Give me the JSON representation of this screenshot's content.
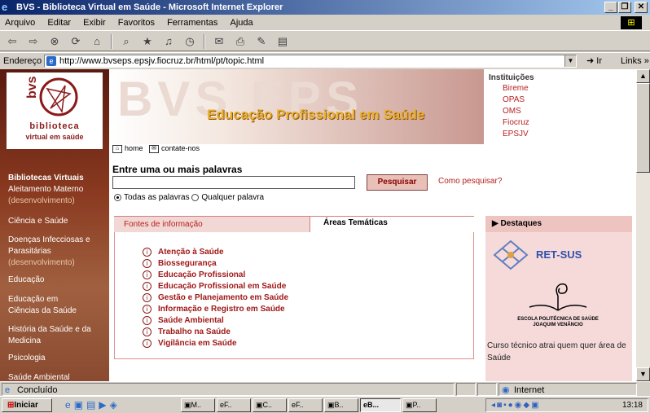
{
  "window": {
    "title": "BVS - Biblioteca Virtual em Saúde - Microsoft Internet Explorer",
    "min": "_",
    "max": "❐",
    "close": "✕"
  },
  "menu": [
    "Arquivo",
    "Editar",
    "Exibir",
    "Favoritos",
    "Ferramentas",
    "Ajuda"
  ],
  "address": {
    "label": "Endereço",
    "url": "http://www.bvseps.epsjv.fiocruz.br/html/pt/topic.html",
    "go": "Ir",
    "links": "Links »"
  },
  "logo": {
    "line1": "biblioteca",
    "line2": "virtual em saúde"
  },
  "banner": {
    "big": "BVS EPS",
    "heading": "Educação Profissional em Saúde"
  },
  "institutions": {
    "title": "Instituições",
    "items": [
      "Bireme",
      "OPAS",
      "OMS",
      "Fiocruz",
      "EPSJV"
    ]
  },
  "toplinks": {
    "home": "home",
    "contact": "contate-nos"
  },
  "search": {
    "title": "Entre uma ou mais palavras",
    "button": "Pesquisar",
    "howto": "Como pesquisar?",
    "opt_all": "Todas as palavras",
    "opt_any": "Qualquer palavra"
  },
  "sidebar": {
    "heading": "Bibliotecas Virtuais",
    "items": [
      {
        "label": "Aleitamento Materno",
        "note": "(desenvolvimento)"
      },
      {
        "label": "Ciência e Saúde"
      },
      {
        "label": "Doenças Infecciosas e Parasitárias",
        "note": "(desenvolvimento)"
      },
      {
        "label": "Educação"
      },
      {
        "label": "Educação em Ciências da Saúde"
      },
      {
        "label": "História da Saúde e da Medicina"
      },
      {
        "label": "Psicologia"
      },
      {
        "label": "Saúde Ambiental"
      }
    ]
  },
  "tabs": {
    "sources": "Fontes de informação",
    "areas": "Áreas Temáticas"
  },
  "topics": [
    "Atenção à Saúde",
    "Biossegurança",
    "Educação Profissional",
    "Educação Profissional em Saúde",
    "Gestão e Planejamento em Saúde",
    "Informação e Registro em Saúde",
    "Saúde Ambiental",
    "Trabalho na Saúde",
    "Vigilância em Saúde"
  ],
  "highlights": {
    "title": "Destaques",
    "retsus": "RET-SUS",
    "escola1": "ESCOLA POLITÉCNICA DE SAÚDE",
    "escola2": "JOAQUIM VENÂNCIO",
    "news": "Curso técnico atrai quem quer área de Saúde"
  },
  "status": {
    "left": "Concluído",
    "zone": "Internet"
  },
  "taskbar": {
    "start": "Iniciar",
    "buttons": [
      "M..",
      "F..",
      "C..",
      "F..",
      "B..",
      "B...",
      "P.."
    ],
    "clock": "13:18"
  }
}
